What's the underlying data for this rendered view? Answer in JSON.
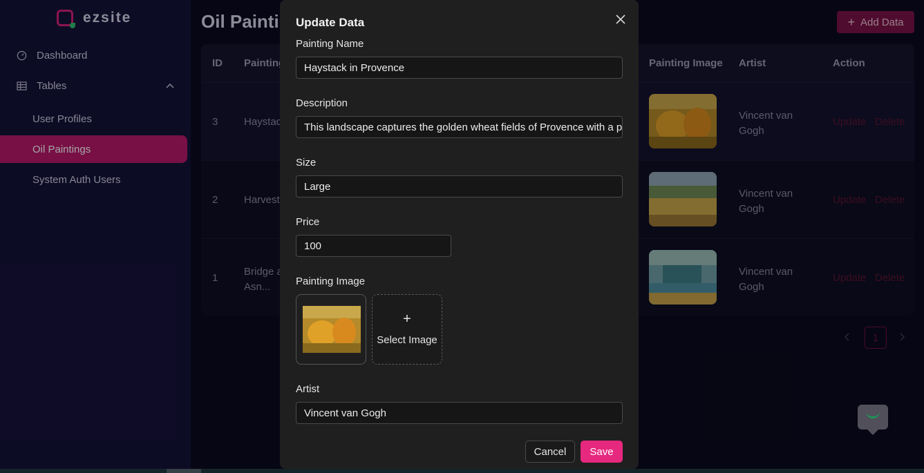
{
  "brand": {
    "name": "ezsite",
    "accent": "#d7217a"
  },
  "sidebar": {
    "items": [
      {
        "label": "Dashboard",
        "icon": "dashboard-icon"
      },
      {
        "label": "Tables",
        "icon": "table-icon"
      },
      {
        "label": "User Profiles"
      },
      {
        "label": "Oil Paintings",
        "active": true
      },
      {
        "label": "System Auth Users"
      }
    ]
  },
  "page": {
    "title": "Oil Paintin",
    "add_label": "Add Data"
  },
  "table": {
    "headers": {
      "id": "ID",
      "painting": "Painting",
      "image": "Painting Image",
      "artist": "Artist",
      "action": "Action"
    },
    "rows": [
      {
        "id": "3",
        "painting": "Haystack",
        "artist": "Vincent van Gogh",
        "update": "Update",
        "delete": "Delete"
      },
      {
        "id": "2",
        "painting": "Harvest",
        "artist": "Vincent van Gogh",
        "update": "Update",
        "delete": "Delete"
      },
      {
        "id": "1",
        "painting": "Bridge a Asn...",
        "artist": "Vincent van Gogh",
        "update": "Update",
        "delete": "Delete"
      }
    ]
  },
  "pagination": {
    "current": "1"
  },
  "modal": {
    "title": "Update Data",
    "fields": {
      "painting_name": {
        "label": "Painting Name",
        "value": "Haystack in Provence"
      },
      "description": {
        "label": "Description",
        "value": "This landscape captures the golden wheat fields of Provence with a prom"
      },
      "size": {
        "label": "Size",
        "value": "Large"
      },
      "price": {
        "label": "Price",
        "value": "100"
      },
      "painting_image": {
        "label": "Painting Image",
        "select_label": "Select Image"
      },
      "artist": {
        "label": "Artist",
        "value": "Vincent van Gogh"
      }
    },
    "cancel_label": "Cancel",
    "save_label": "Save",
    "save_color": "#e6287f"
  }
}
